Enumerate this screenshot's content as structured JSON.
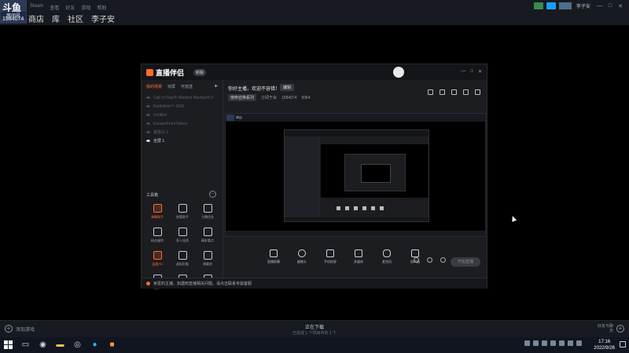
{
  "overlay": {
    "logo_text": "斗鱼",
    "room_label": "房间号",
    "room_id": "1984074"
  },
  "steam": {
    "menu": [
      "Steam",
      "查看",
      "好友",
      "游戏",
      "帮助"
    ],
    "nav": [
      {
        "label": "商店"
      },
      {
        "label": "库"
      },
      {
        "label": "社区"
      },
      {
        "label": "李子安"
      }
    ],
    "user_name": "李子安",
    "add_game_label": "添加游戏",
    "downloads_title": "正在下载",
    "downloads_sub": "已完成 1 个项目中的 1 个",
    "friends_label": "好友与聊天",
    "accent_color": "#1a9fff"
  },
  "app": {
    "brand": "直播伴侣",
    "version_badge": "新版",
    "window_buttons": [
      "—",
      "□",
      "✕"
    ],
    "sidebar": {
      "tabs": [
        {
          "label": "我的场景",
          "active": true
        },
        {
          "label": "双屏",
          "active": false
        },
        {
          "label": "可放送",
          "active": false
        }
      ],
      "add_label": "+",
      "scenes": [
        {
          "name": "Call of Duty®: Modern Warfare® II",
          "visible": false
        },
        {
          "name": "Battlefield™ 2042",
          "visible": false
        },
        {
          "name": "Untitled",
          "visible": false
        },
        {
          "name": "EscapeFromTarkov",
          "visible": false
        },
        {
          "name": "摄像头 1",
          "visible": false
        },
        {
          "name": "全屏 1",
          "visible": true
        }
      ],
      "tools_header": "工具箱",
      "tools_more": "⋯",
      "tools": [
        {
          "label": "弹幕助手",
          "hot": true
        },
        {
          "label": "房管助手",
          "hot": false
        },
        {
          "label": "主播任务",
          "hot": false
        },
        {
          "label": "粉丝福利",
          "hot": false
        },
        {
          "label": "多人连线",
          "hot": false
        },
        {
          "label": "精彩看点",
          "hot": false
        },
        {
          "label": "连麦PK",
          "hot": true
        },
        {
          "label": "虚拟形象",
          "hot": false
        },
        {
          "label": "弹幕库",
          "hot": false
        },
        {
          "label": "更多",
          "hot": false
        },
        {
          "label": "",
          "hot": false
        },
        {
          "label": "",
          "hot": false
        }
      ]
    },
    "main": {
      "stream_title": "你好主播，欢迎不容错！",
      "edit_label": "编辑",
      "category": "使命召唤系列",
      "meta_fans": "订阅于会",
      "meta_room": "1984074",
      "meta_heat": "5064",
      "controls": [
        {
          "label": "直播屏幕"
        },
        {
          "label": "摄像头"
        },
        {
          "label": "手机投屏"
        },
        {
          "label": "多媒体"
        },
        {
          "label": "麦克风"
        },
        {
          "label": "扬声器"
        }
      ],
      "start_label": "开始直播",
      "stats": [
        "码率 0kb/s",
        "FPS:60",
        "丢帧率 0.0%",
        "CPU:9%",
        "内存:58%",
        "未开播"
      ]
    },
    "notice": "亲爱的主播，如遇到直播相关问题，请点击联系专属客服"
  },
  "taskbar": {
    "time": "17:16",
    "date": "2022/9/26"
  }
}
